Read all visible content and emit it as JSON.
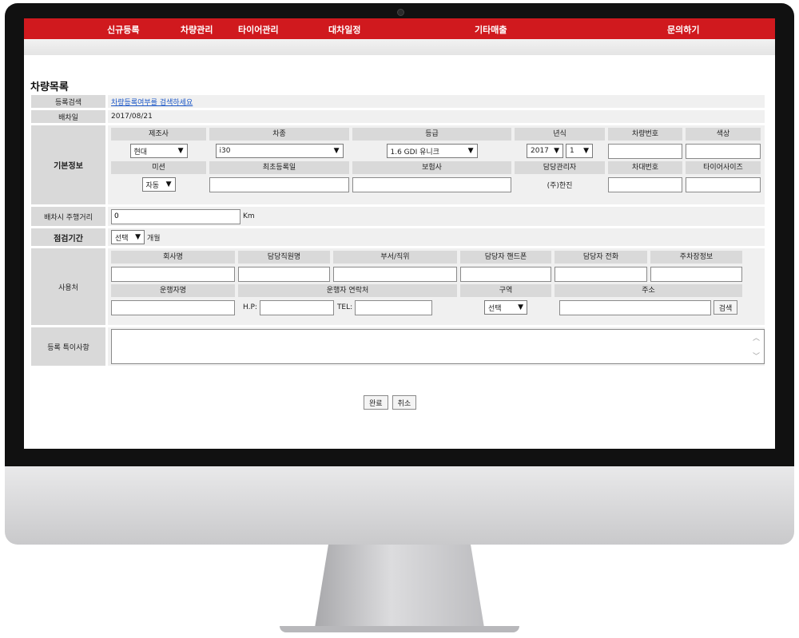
{
  "nav": {
    "items": [
      "신규등록",
      "차량관리",
      "타이어관리",
      "대차일정",
      "기타매출",
      "문의하기"
    ]
  },
  "page_title": "차량목록",
  "register_search": {
    "label": "등록검색",
    "link": "차량등록여부를 검색하세요"
  },
  "dispatch_date": {
    "label": "배차일",
    "value": "2017/08/21"
  },
  "basic_info": {
    "label": "기본정보",
    "headers1": [
      "제조사",
      "차종",
      "등급",
      "년식",
      "차량번호",
      "색상"
    ],
    "maker": "현대",
    "model": "i30",
    "grade": "1.6 GDI 유니크",
    "year": "2017",
    "month": "1",
    "car_number": "",
    "color": "",
    "headers2": [
      "미션",
      "최초등록일",
      "보험사",
      "담당관리자",
      "차대번호",
      "타이어사이즈"
    ],
    "transmission": "자동",
    "first_reg_date": "",
    "insurer": "",
    "manager": "(주)한진",
    "vin": "",
    "tire_size": ""
  },
  "mileage": {
    "label": "배차시 주행거리",
    "value": "0",
    "unit": "Km"
  },
  "inspection": {
    "label": "점검기간",
    "select": "선택",
    "unit": "개월"
  },
  "user": {
    "label": "사용처",
    "headers1": [
      "회사명",
      "담당직원명",
      "부서/직위",
      "담당자 핸드폰",
      "담당자 전화",
      "주차장정보"
    ],
    "headers2": [
      "운행자명",
      "운행자 연락처",
      "구역",
      "주소"
    ],
    "hp_label": "H.P:",
    "tel_label": "TEL:",
    "zone_select": "선택",
    "search_button": "검색"
  },
  "notes": {
    "label": "등록 특이사항",
    "value": ""
  },
  "actions": {
    "confirm": "완료",
    "cancel": "취소"
  }
}
